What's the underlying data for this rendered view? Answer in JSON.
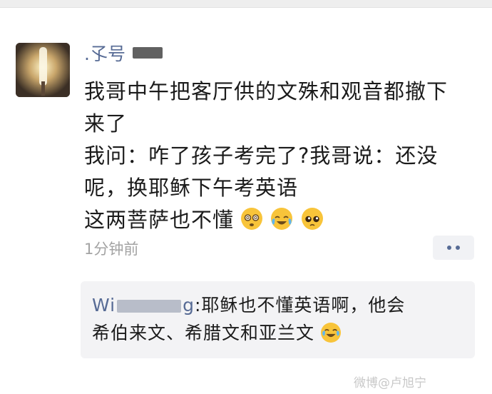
{
  "post": {
    "username": ".孓号",
    "lines": [
      "我哥中午把客厅供的文殊和观音都撤下",
      "来了",
      "我问：咋了孩子考完了?我哥说：还没",
      "呢，换耶稣下午考英语",
      "这两菩萨也不懂"
    ],
    "emojis": [
      "dizzy-face-emoji",
      "crying-laughing-emoji",
      "pleading-face-emoji"
    ],
    "timestamp": "1分钟前",
    "more_icon": "more-dots-icon"
  },
  "comment": {
    "commenter": "Wi",
    "commenter_tail": "g",
    "line1_text": ":耶稣也不懂英语啊，他会",
    "line2_text": "希伯来文、希腊文和亚兰文",
    "emoji": "tears-of-joy-emoji"
  },
  "watermark": "微博@卢旭宁",
  "colors": {
    "link": "#576b95",
    "text": "#1b1b1b",
    "muted": "#a3a3a3",
    "comment_bg": "#f3f3f5"
  }
}
